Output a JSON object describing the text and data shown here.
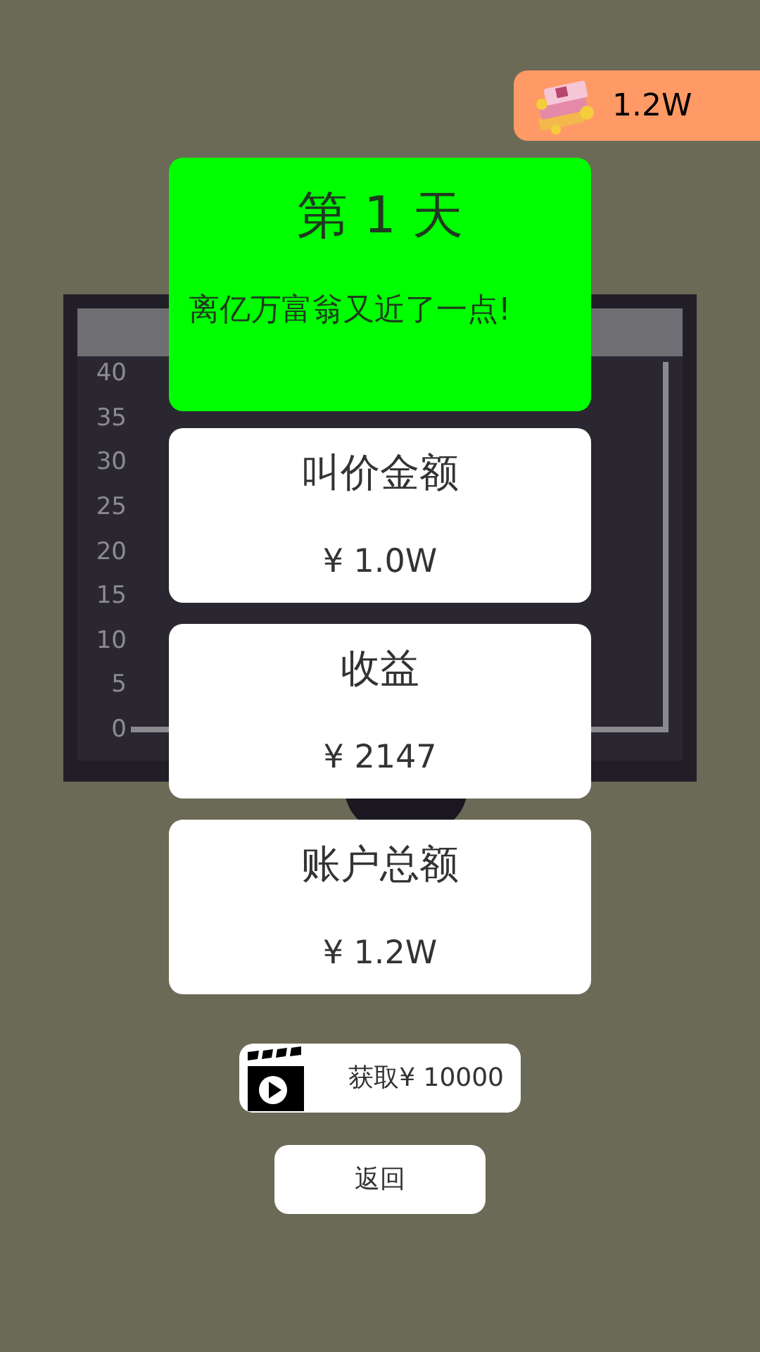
{
  "wallet": {
    "amount": "1.2W"
  },
  "chart": {
    "y_axis_labels": [
      "40",
      "35",
      "30",
      "25",
      "20",
      "15",
      "10",
      "5",
      "0"
    ]
  },
  "result": {
    "day": "第 1 天",
    "message": "离亿万富翁又近了一点!"
  },
  "stats": [
    {
      "label": "叫价金额",
      "value": "¥ 1.0W"
    },
    {
      "label": "收益",
      "value": "¥ 2147"
    },
    {
      "label": "账户总额",
      "value": "¥ 1.2W"
    }
  ],
  "reward_button": {
    "label": "获取¥ 10000"
  },
  "back_button": {
    "label": "返回"
  }
}
